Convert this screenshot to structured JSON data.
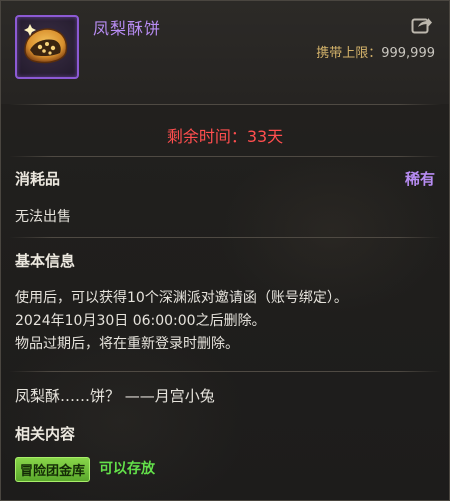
{
  "item": {
    "name": "凤梨酥饼",
    "icon": "pineapple-cake-icon",
    "carry_label": "携带上限：",
    "carry_value": "999,999"
  },
  "expiry": {
    "remaining": "剩余时间：33天"
  },
  "type": {
    "category": "消耗品",
    "rarity": "稀有",
    "sell": "无法出售"
  },
  "basic_info": {
    "heading": "基本信息",
    "lines": [
      "使用后，可以获得10个深渊派对邀请函（账号绑定）。",
      "2024年10月30日 06:00:00之后删除。",
      "物品过期后，将在重新登录时删除。"
    ]
  },
  "flavor": {
    "text": "凤梨酥……饼？ ——月宫小兔"
  },
  "related": {
    "heading": "相关内容",
    "tag": "冒险团金库",
    "status": "可以存放"
  },
  "colors": {
    "rarity": "#b78cf2",
    "expiry": "#ff4e4e",
    "storable": "#63e04a"
  }
}
